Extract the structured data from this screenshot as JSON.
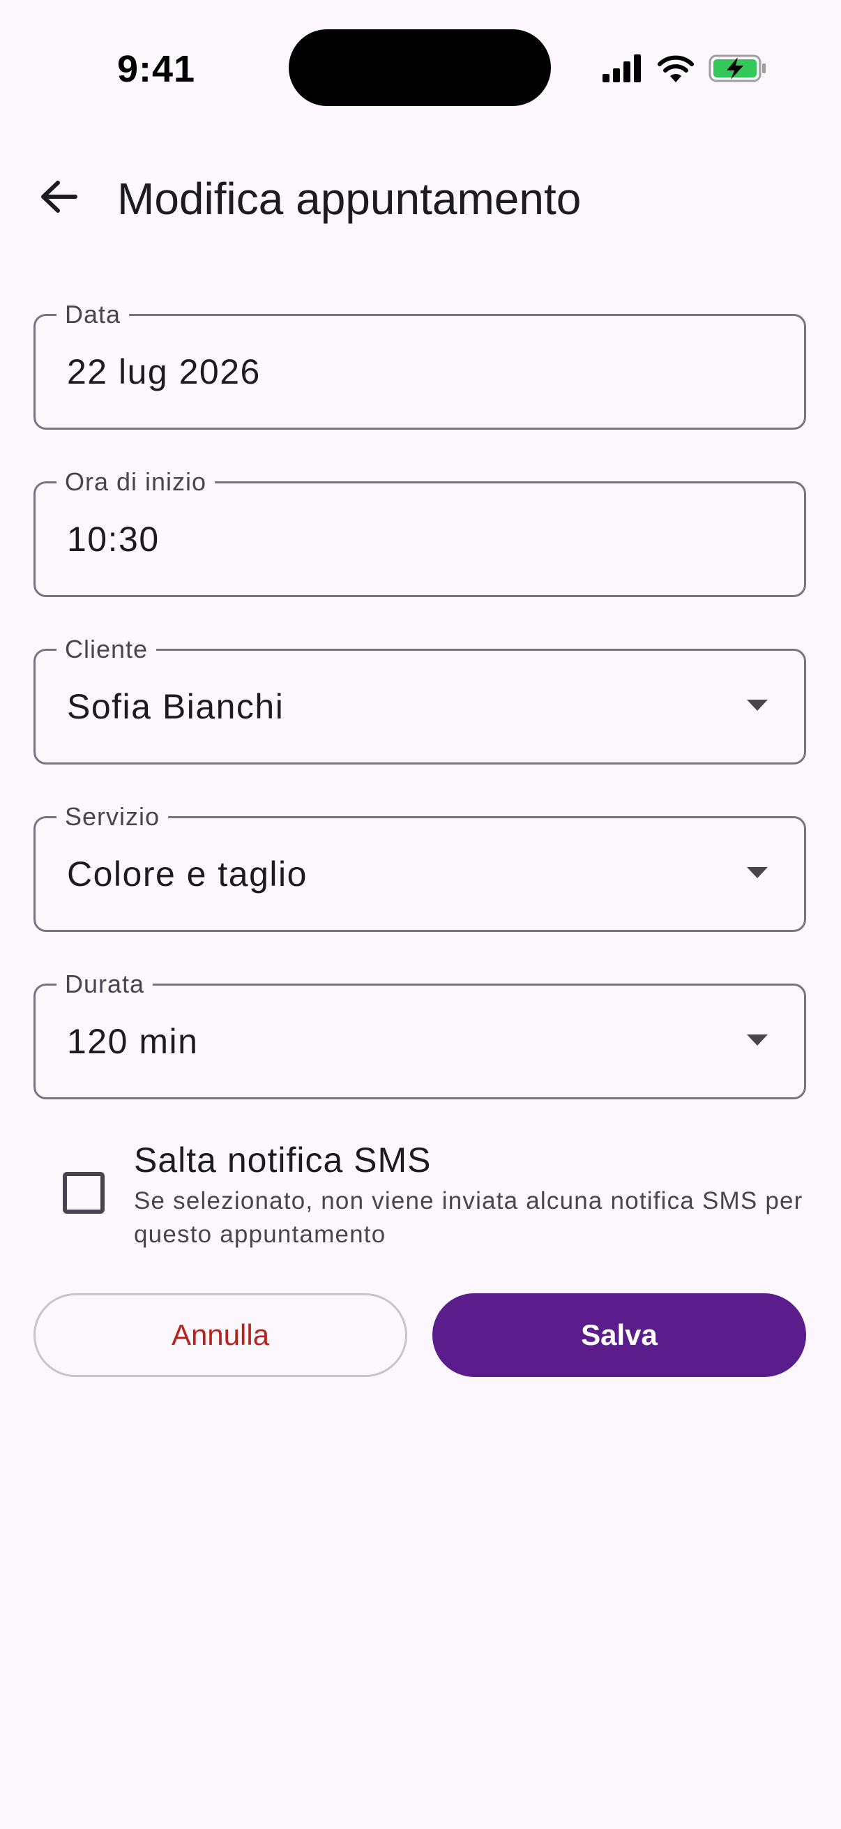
{
  "status_bar": {
    "time": "9:41"
  },
  "app_bar": {
    "title": "Modifica appuntamento"
  },
  "form": {
    "date": {
      "label": "Data",
      "value": "22 lug 2026"
    },
    "start_time": {
      "label": "Ora di inizio",
      "value": "10:30"
    },
    "client": {
      "label": "Cliente",
      "value": "Sofia Bianchi"
    },
    "service": {
      "label": "Servizio",
      "value": "Colore e taglio"
    },
    "duration": {
      "label": "Durata",
      "value": "120 min"
    }
  },
  "skip_sms": {
    "title": "Salta notifica SMS",
    "subtitle": "Se selezionato, non viene inviata alcuna notifica SMS per questo appuntamento",
    "checked": false
  },
  "actions": {
    "cancel_label": "Annulla",
    "save_label": "Salva"
  },
  "colors": {
    "background": "#FCF7FC",
    "primary": "#5B1D8C",
    "cancel_text": "#B3261E",
    "outline": "#79747E",
    "battery_fill": "#34C759"
  },
  "icons": {
    "back": "arrow-left-icon",
    "dropdown": "triangle-down-icon",
    "signal": "cellular-signal-icon",
    "wifi": "wifi-icon",
    "battery": "battery-charging-icon"
  }
}
